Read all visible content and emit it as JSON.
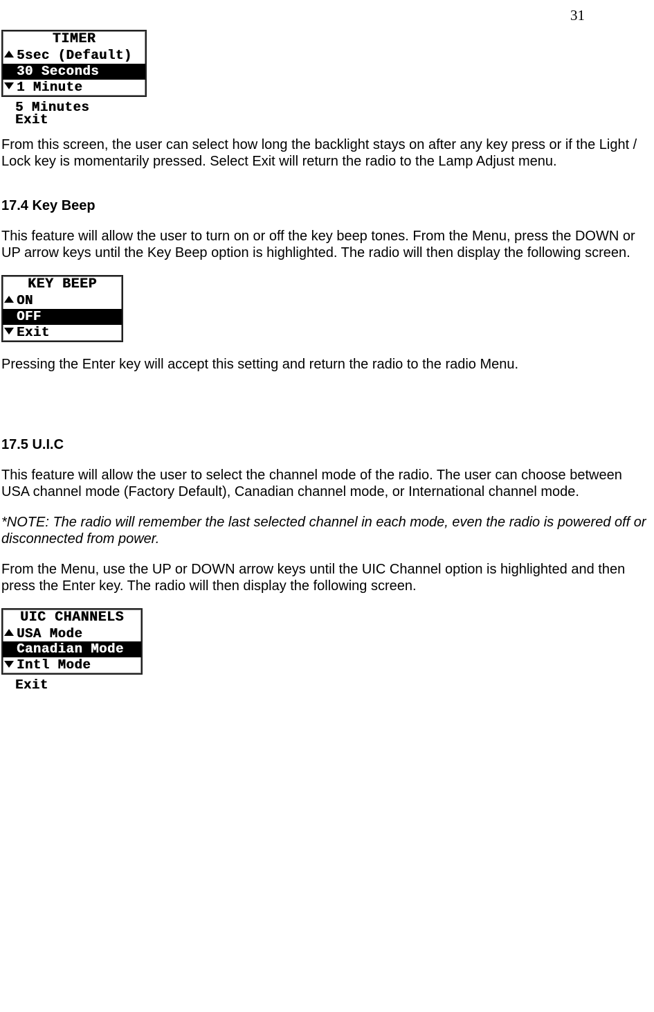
{
  "page_number": "31",
  "screen1": {
    "title": "TIMER",
    "rows": [
      "5sec (Default)",
      "30 Seconds",
      "1 Minute"
    ],
    "selected_index": 1,
    "below": [
      "5 Minutes",
      "Exit"
    ]
  },
  "para1": "From this screen, the user can select how long the backlight stays on after any key press or if the Light / Lock key is momentarily pressed. Select Exit will return the radio to the Lamp Adjust menu.",
  "heading_174": "17.4 Key Beep",
  "para2": "This feature will allow the user to turn on or off the key beep tones. From the Menu, press the DOWN or UP arrow keys until the Key Beep option is highlighted. The radio will then display the following screen.",
  "screen2": {
    "title": "KEY BEEP",
    "rows": [
      "ON",
      "OFF",
      "Exit"
    ],
    "selected_index": 1
  },
  "para3": "Pressing the Enter key will accept this setting and return the radio to the radio Menu.",
  "heading_175": "17.5 U.I.C",
  "para4": "This feature will allow the user to select the channel mode of the radio. The user can choose between USA channel mode (Factory Default), Canadian channel mode, or International channel mode.",
  "note": "*NOTE: The radio will remember the last selected channel in each mode, even the radio is powered off or disconnected from power.",
  "para5": "From the Menu, use the UP or DOWN arrow keys until the UIC Channel option is highlighted and then press the Enter key. The radio will then display the following screen.",
  "screen3": {
    "title": "UIC CHANNELS",
    "rows": [
      "USA Mode",
      "Canadian Mode",
      "Intl Mode"
    ],
    "selected_index": 1,
    "below": [
      "Exit"
    ]
  }
}
